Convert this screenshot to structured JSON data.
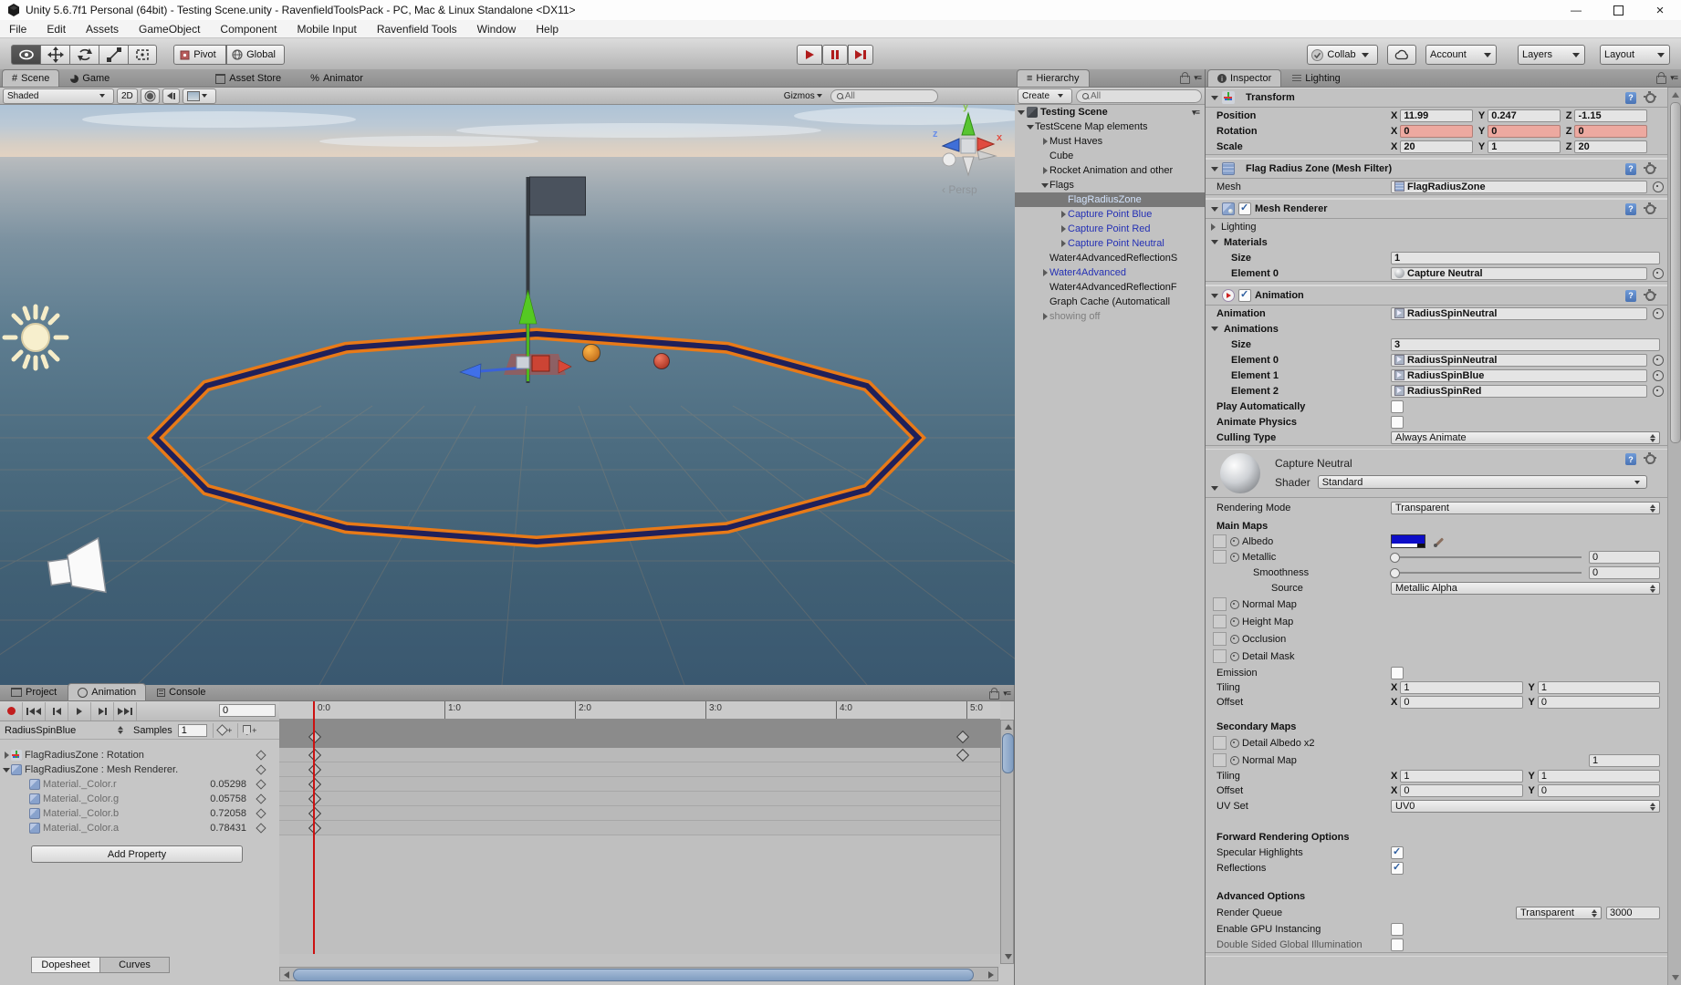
{
  "window": {
    "title": "Unity 5.6.7f1 Personal (64bit) - Testing Scene.unity - RavenfieldToolsPack - PC, Mac & Linux Standalone <DX11>",
    "minimize": "—",
    "close": "×"
  },
  "menubar": [
    "File",
    "Edit",
    "Assets",
    "GameObject",
    "Component",
    "Mobile Input",
    "Ravenfield Tools",
    "Window",
    "Help"
  ],
  "toolbar": {
    "pivot": "Pivot",
    "global": "Global",
    "collab": "Collab",
    "account": "Account",
    "layers": "Layers",
    "layout": "Layout"
  },
  "scene_tabs": {
    "scene": "Scene",
    "game": "Game",
    "asset_store": "Asset Store",
    "animator": "Animator"
  },
  "scene_controls": {
    "shaded": "Shaded",
    "two_d": "2D",
    "gizmos": "Gizmos",
    "search_placeholder": "All"
  },
  "viewport": {
    "persp": "Persp",
    "axis_x": "x",
    "axis_y": "y",
    "axis_z": "z"
  },
  "colors": {
    "ring_orange": "#e87a18",
    "ring_navy": "#20205a",
    "albedo_swatch": "#0d0dc8",
    "animated_field": "#eda9a0",
    "prefab_text": "#2430b4",
    "record_red": "#c21d1d"
  },
  "hierarchy": {
    "tab": "Hierarchy",
    "create": "Create",
    "search_placeholder": "All",
    "root": "Testing Scene",
    "items": [
      {
        "label": "TestScene Map elements",
        "cls": "d1",
        "arrow": "open"
      },
      {
        "label": "Must Haves",
        "cls": "d2",
        "arrow": "closed"
      },
      {
        "label": "Cube",
        "cls": "d2",
        "arrow": "none"
      },
      {
        "label": "Rocket Animation and other",
        "cls": "d2",
        "arrow": "closed"
      },
      {
        "label": "Flags",
        "cls": "d2",
        "arrow": "open"
      },
      {
        "label": "FlagRadiusZone",
        "cls": "d3 sel",
        "arrow": "none"
      },
      {
        "label": "Capture Point Blue",
        "cls": "d3 prefab",
        "arrow": "closed"
      },
      {
        "label": "Capture Point Red",
        "cls": "d3 prefab",
        "arrow": "closed"
      },
      {
        "label": "Capture Point Neutral",
        "cls": "d3 prefab",
        "arrow": "closed"
      },
      {
        "label": "Water4AdvancedReflectionS",
        "cls": "d2",
        "arrow": "none"
      },
      {
        "label": "Water4Advanced",
        "cls": "d2 prefab",
        "arrow": "closed"
      },
      {
        "label": "Water4AdvancedReflectionF",
        "cls": "d2",
        "arrow": "none"
      },
      {
        "label": "Graph Cache (Automaticall",
        "cls": "d2",
        "arrow": "none"
      },
      {
        "label": "showing off",
        "cls": "d2 dis",
        "arrow": "closed"
      }
    ]
  },
  "inspector": {
    "tabs": {
      "inspector": "Inspector",
      "lighting": "Lighting"
    },
    "transform": {
      "title": "Transform",
      "axis": {
        "x": "X",
        "y": "Y",
        "z": "Z"
      },
      "rows": [
        {
          "label": "Position",
          "x": "11.99",
          "y": "0.247",
          "z": "-1.15",
          "animated": ""
        },
        {
          "label": "Rotation",
          "x": "0",
          "y": "0",
          "z": "0",
          "animated": "animated"
        },
        {
          "label": "Scale",
          "x": "20",
          "y": "1",
          "z": "20",
          "animated": ""
        }
      ]
    },
    "mesh_filter": {
      "title": "Flag Radius Zone (Mesh Filter)",
      "mesh_label": "Mesh",
      "mesh_value": "FlagRadiusZone"
    },
    "mesh_renderer": {
      "title": "Mesh Renderer",
      "lighting_label": "Lighting",
      "materials_label": "Materials",
      "size_label": "Size",
      "size_value": "1",
      "element0_label": "Element 0",
      "element0_value": "Capture Neutral"
    },
    "animation_component": {
      "title": "Animation",
      "animation_label": "Animation",
      "animation_value": "RadiusSpinNeutral",
      "animations_label": "Animations",
      "size_label": "Size",
      "size_value": "3",
      "elements": [
        {
          "label": "Element 0",
          "value": "RadiusSpinNeutral"
        },
        {
          "label": "Element 1",
          "value": "RadiusSpinBlue"
        },
        {
          "label": "Element 2",
          "value": "RadiusSpinRed"
        }
      ],
      "play_label": "Play Automatically",
      "physics_label": "Animate Physics",
      "culling_label": "Culling Type",
      "culling_value": "Always Animate"
    },
    "material": {
      "name": "Capture Neutral",
      "shader_label": "Shader",
      "shader_value": "Standard",
      "rendering_mode_label": "Rendering Mode",
      "rendering_mode_value": "Transparent",
      "main_maps_title": "Main Maps",
      "albedo_label": "Albedo",
      "metallic_label": "Metallic",
      "metallic_value": "0",
      "smoothness_label": "Smoothness",
      "smoothness_value": "0",
      "source_label": "Source",
      "source_value": "Metallic Alpha",
      "maps": [
        {
          "label": "Normal Map"
        },
        {
          "label": "Height Map"
        },
        {
          "label": "Occlusion"
        },
        {
          "label": "Detail Mask"
        }
      ],
      "emission_label": "Emission",
      "tiling_label": "Tiling",
      "offset_label": "Offset",
      "x_label": "X",
      "y_label": "Y",
      "main_tiling_x": "1",
      "main_tiling_y": "1",
      "main_offset_x": "0",
      "main_offset_y": "0",
      "secondary_title": "Secondary Maps",
      "detail_albedo_label": "Detail Albedo x2",
      "secondary_normal_label": "Normal Map",
      "secondary_normal_value": "1",
      "sec_tiling_x": "1",
      "sec_tiling_y": "1",
      "sec_offset_x": "0",
      "sec_offset_y": "0",
      "uv_label": "UV Set",
      "uv_value": "UV0",
      "forward_title": "Forward Rendering Options",
      "specular_label": "Specular Highlights",
      "reflections_label": "Reflections",
      "advanced_title": "Advanced Options",
      "render_queue_label": "Render Queue",
      "render_queue_mode": "Transparent",
      "render_queue_value": "3000",
      "gpu_label": "Enable GPU Instancing",
      "double_label": "Double Sided Global Illumination",
      "albedo_color": "#0d0dc8"
    }
  },
  "animation": {
    "tabs": {
      "project": "Project",
      "animation": "Animation",
      "console": "Console"
    },
    "frame": "0",
    "clip": "RadiusSpinBlue",
    "samples_label": "Samples",
    "samples_value": "1",
    "add_property": "Add Property",
    "dopesheet": "Dopesheet",
    "curves": "Curves",
    "ruler": [
      "0:0",
      "1:0",
      "2:0",
      "3:0",
      "4:0",
      "5:0"
    ],
    "summary_keys": [
      0,
      5
    ],
    "tracks": [
      {
        "name": "FlagRadiusZone : Rotation",
        "value": "",
        "icon": "transform",
        "arrow": "closed",
        "cls": "",
        "kcls": "k0 k5",
        "keys": [
          0,
          5
        ]
      },
      {
        "name": "FlagRadiusZone : Mesh Renderer.",
        "value": "",
        "icon": "renderer",
        "arrow": "open",
        "cls": "",
        "kcls": "k0",
        "keys": [
          0
        ]
      },
      {
        "name": "Material._Color.r",
        "value": "0.05298",
        "icon": "renderer",
        "arrow": "none",
        "cls": "sub",
        "kcls": "k0",
        "keys": [
          0
        ]
      },
      {
        "name": "Material._Color.g",
        "value": "0.05758",
        "icon": "renderer",
        "arrow": "none",
        "cls": "sub",
        "kcls": "k0",
        "keys": [
          0
        ]
      },
      {
        "name": "Material._Color.b",
        "value": "0.72058",
        "icon": "renderer",
        "arrow": "none",
        "cls": "sub",
        "kcls": "k0",
        "keys": [
          0
        ]
      },
      {
        "name": "Material._Color.a",
        "value": "0.78431",
        "icon": "renderer",
        "arrow": "none",
        "cls": "sub",
        "kcls": "k0",
        "keys": [
          0
        ]
      }
    ]
  }
}
